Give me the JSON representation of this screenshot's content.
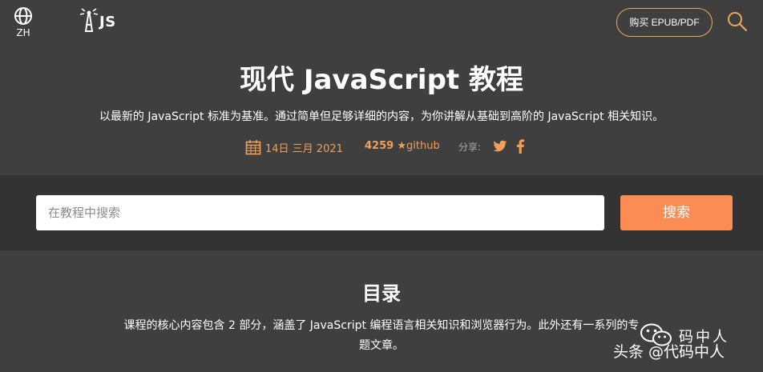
{
  "header": {
    "language_label": "ZH",
    "logo_text": "JS",
    "buy_label": "购买 EPUB/PDF"
  },
  "hero": {
    "title": "现代 JavaScript 教程",
    "subtitle": "以最新的 JavaScript 标准为基准。通过简单但足够详细的内容，为你讲解从基础到高阶的 JavaScript 相关知识。",
    "date": "14日 三月 2021",
    "stars": "4259",
    "star_symbol": "★",
    "github_label": "github",
    "share_label": "分享:"
  },
  "search": {
    "placeholder": "在教程中搜索",
    "button_label": "搜索"
  },
  "toc": {
    "title": "目录",
    "description": "课程的核心内容包含 2 部分，涵盖了 JavaScript 编程语言相关知识和浏览器行为。此外还有一系列的专题文章。"
  },
  "watermark": {
    "name": "码中人",
    "source": "头条 @代码中人"
  },
  "colors": {
    "background": "#3f3f3f",
    "search_band": "#333333",
    "accent_orange": "#fa8c54",
    "meta_orange": "#f0a05a",
    "border_gold": "#e8a85a"
  },
  "icons": {
    "language": "globe-icon",
    "logo": "lighthouse-icon",
    "search": "search-icon",
    "date": "calendar-icon",
    "twitter": "twitter-icon",
    "facebook": "facebook-icon",
    "wechat": "wechat-icon"
  }
}
